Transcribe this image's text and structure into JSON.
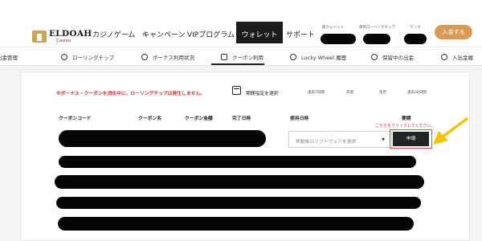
{
  "brand": {
    "name": "ELDOAH",
    "sub": "Casino",
    "accent": "#c8a35a"
  },
  "nav": {
    "items": [
      "カジノゲーム",
      "キャンペーン",
      "VIPプログラム",
      "サポート"
    ],
    "active": "ウォレット"
  },
  "account": {
    "credit_label": "総クレジット",
    "rolling_label": "保有ローリングチップ",
    "rank_label": "ランク",
    "join_label": "入金する"
  },
  "subnav": {
    "items": [
      "出金管理",
      "ローリングチップ",
      "ボーナス利用状況",
      "クーポン利用",
      "Lucky Wheel 履歴",
      "保留中の出金",
      "入出金履"
    ],
    "active_index": 3
  },
  "panel": {
    "notice": "※ボーナス・クーポンを消化中に、ローリングチップは発生しません。",
    "date_select": "期間指定を選択",
    "ranges": [
      "過去7日間",
      "先週",
      "先月",
      "過去30日間"
    ],
    "columns": [
      "クーポンコード",
      "クーポン名",
      "クーポン金額",
      "完了日時",
      "使用日時",
      "要請"
    ],
    "click_hint": "こちらをクリックしてください。",
    "dropdown_placeholder": "移動後のソフトウェアを選択",
    "dropdown_arrow": "▼",
    "apply_label": "申請"
  },
  "colors": {
    "arrow": "#f2c400",
    "hint": "#e0333a",
    "notice": "#d23434"
  }
}
